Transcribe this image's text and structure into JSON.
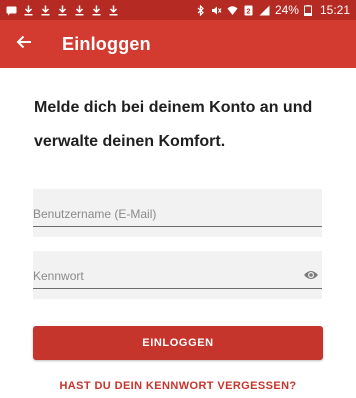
{
  "status_bar": {
    "battery": "24%",
    "time": "15:21",
    "icons": [
      "message-icon",
      "download-icon",
      "download-icon",
      "download-icon",
      "download-icon",
      "download-icon",
      "download-icon",
      "bluetooth-icon",
      "mute-icon",
      "wifi-icon",
      "sim-icon",
      "signal-icon",
      "battery-icon"
    ]
  },
  "app_bar": {
    "title": "Einloggen",
    "background": "#d33b30"
  },
  "headline": "Melde dich bei deinem Konto an und verwalte deinen Komfort.",
  "form": {
    "username_placeholder": "Benutzername (E-Mail)",
    "password_placeholder": "Kennwort"
  },
  "buttons": {
    "login_label": "EINLOGGEN",
    "forgot_label": "HAST DU DEIN KENNWORT VERGESSEN?"
  },
  "colors": {
    "accent": "#c6352b",
    "status_bar": "#b52a22"
  }
}
